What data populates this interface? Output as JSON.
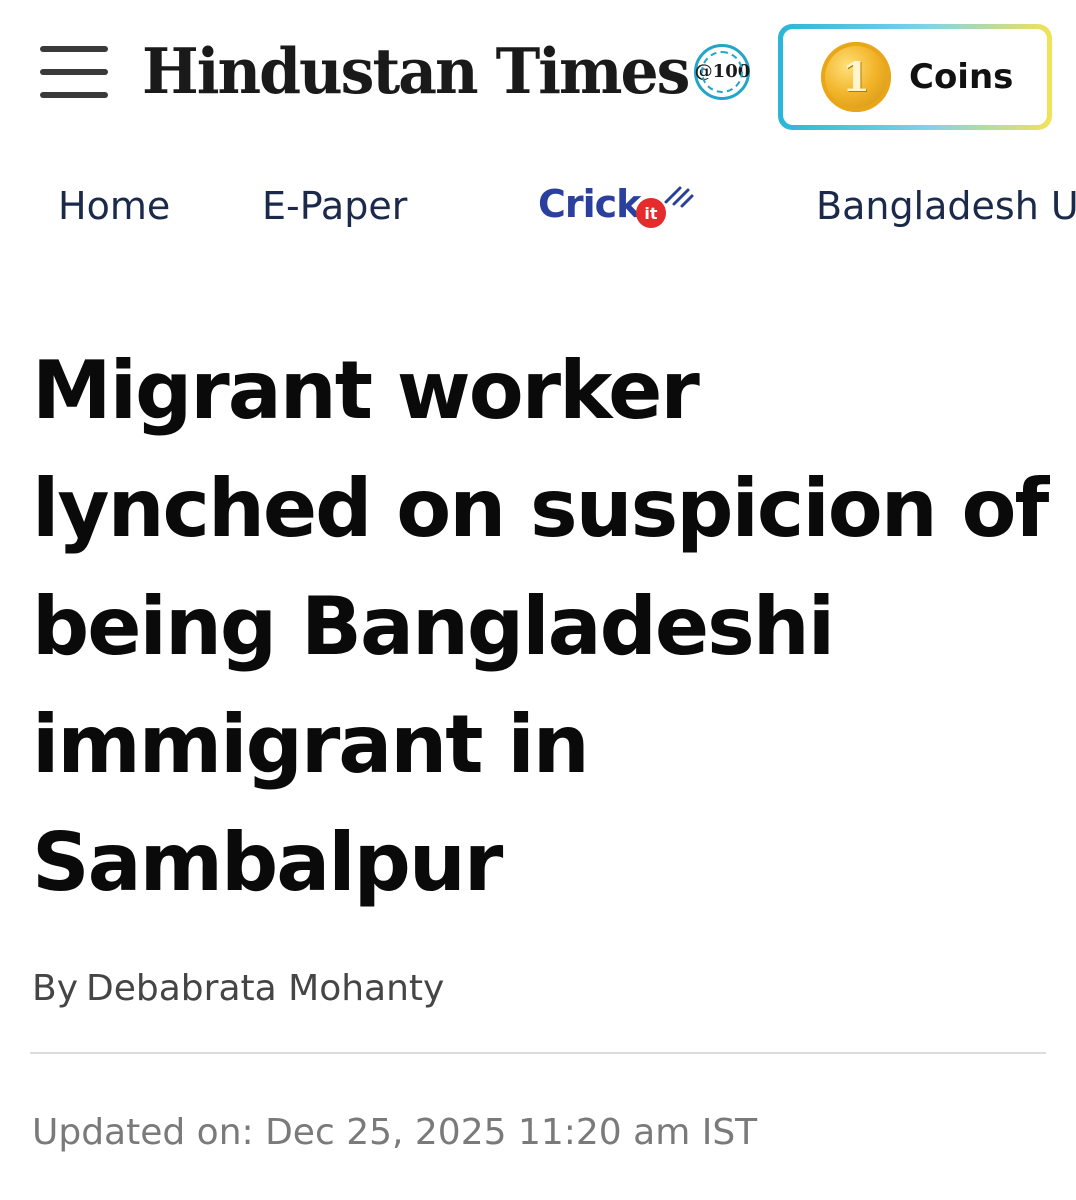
{
  "header": {
    "menu_icon": "hamburger-menu-icon",
    "logo_text": "Hindustan Times",
    "logo_badge": "@100",
    "coins": {
      "icon": "coin-icon",
      "icon_glyph": "1",
      "label": "Coins"
    }
  },
  "nav": {
    "items": [
      {
        "label": "Home"
      },
      {
        "label": "E-Paper"
      },
      {
        "label": "Crickit",
        "brand_main": "Crick",
        "brand_dot": "it",
        "brand_color": "#2b3f9e",
        "dot_color": "#e52b2b"
      },
      {
        "label": "Bangladesh Ur"
      }
    ]
  },
  "article": {
    "headline": "Migrant worker lynched on suspicion of being Bangladeshi immigrant in Sambalpur",
    "byline_prefix": "By",
    "author": "Debabrata Mohanty",
    "updated": "Updated on: Dec 25, 2025 11:20 am IST"
  },
  "colors": {
    "nav_text": "#1b2a4a",
    "coins_gradient_start": "#29b6d8",
    "coins_gradient_end": "#f3e255",
    "badge_accent": "#22a5c9"
  }
}
